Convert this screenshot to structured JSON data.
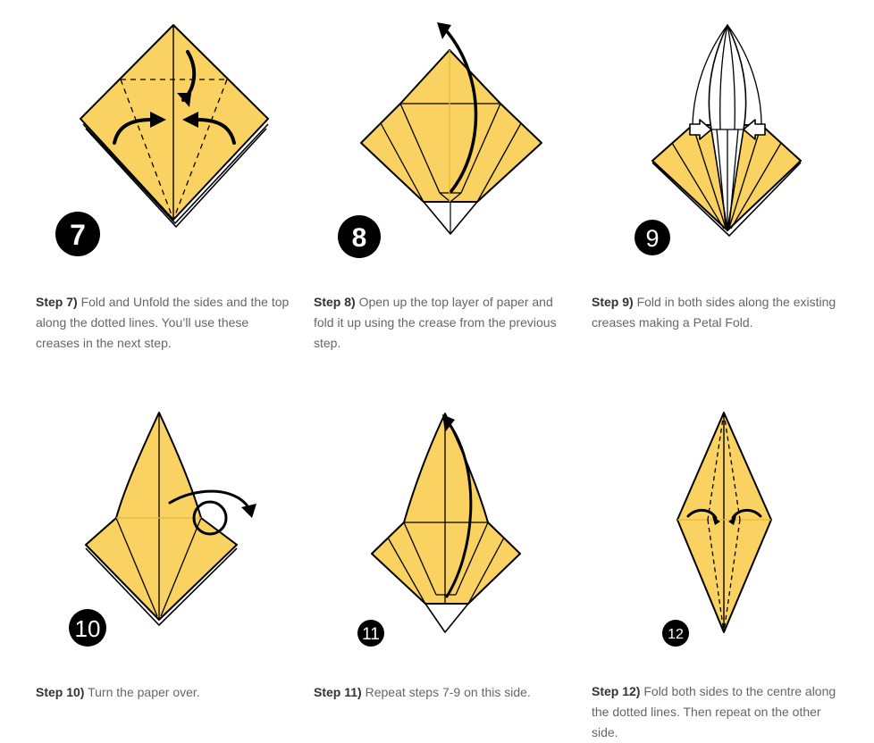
{
  "steps": [
    {
      "number": "7",
      "label": "Step 7)",
      "text": "Fold and Unfold the sides and the top along the dotted lines. You’ll use these creases in the next step."
    },
    {
      "number": "8",
      "label": "Step 8)",
      "text": "Open up the top layer of paper and fold it up using the crease from the previous step."
    },
    {
      "number": "9",
      "label": "Step 9)",
      "text": "Fold in both sides along the existing creases making a Petal Fold."
    },
    {
      "number": "10",
      "label": "Step 10)",
      "text": "Turn the paper over."
    },
    {
      "number": "11",
      "label": "Step 11)",
      "text": "Repeat steps 7-9 on this side."
    },
    {
      "number": "12",
      "label": "Step 12)",
      "text": "Fold both sides to the centre along the dotted lines. Then repeat on the other side."
    }
  ],
  "colors": {
    "paper": "#F9D262",
    "crease": "#E8B93A",
    "outline": "#000000",
    "text": "#666666",
    "label": "#333333"
  }
}
